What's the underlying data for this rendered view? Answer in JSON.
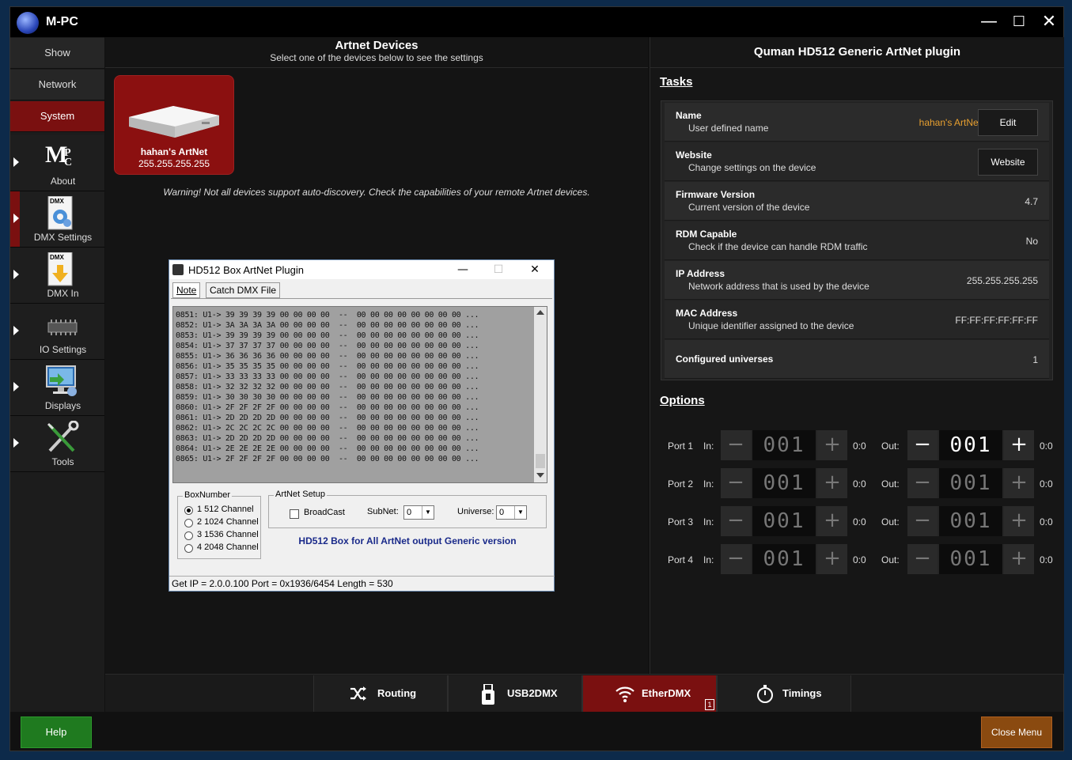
{
  "app": {
    "title": "M-PC"
  },
  "window_controls": {
    "minimize": "—",
    "maximize": "☐",
    "close": "✕"
  },
  "sidebar": {
    "buttons": [
      {
        "label": "Show",
        "active": false
      },
      {
        "label": "Network",
        "active": false
      },
      {
        "label": "System",
        "active": true
      }
    ],
    "items": [
      {
        "label": "About",
        "icon": "mc-logo-icon",
        "active": false
      },
      {
        "label": "DMX Settings",
        "icon": "dmx-settings-icon",
        "active": true
      },
      {
        "label": "DMX In",
        "icon": "dmx-in-icon",
        "active": false
      },
      {
        "label": "IO Settings",
        "icon": "chip-icon",
        "active": false
      },
      {
        "label": "Displays",
        "icon": "monitor-icon",
        "active": false
      },
      {
        "label": "Tools",
        "icon": "tools-icon",
        "active": false
      }
    ]
  },
  "center": {
    "title": "Artnet Devices",
    "subtitle": "Select one of the devices below to see the settings",
    "device": {
      "name": "hahan's ArtNet",
      "ip": "255.255.255.255"
    },
    "warning": "Warning! Not all devices support auto-discovery. Check the capabilities of your remote Artnet devices."
  },
  "right": {
    "title": "Quman HD512 Generic ArtNet plugin",
    "tasks_heading": "Tasks",
    "options_heading": "Options",
    "tasks": [
      {
        "name": "Name",
        "desc": "User defined name",
        "value": "hahan's ArtNet",
        "button": "Edit"
      },
      {
        "name": "Website",
        "desc": "Change settings on the device",
        "value": "",
        "button": "Website"
      },
      {
        "name": "Firmware Version",
        "desc": "Current version of the device",
        "value": "4.7",
        "button": ""
      },
      {
        "name": "RDM Capable",
        "desc": "Check if the device can handle RDM traffic",
        "value": "No",
        "button": ""
      },
      {
        "name": "IP Address",
        "desc": "Network address that is used by the device",
        "value": "255.255.255.255",
        "button": ""
      },
      {
        "name": "MAC Address",
        "desc": "Unique identifier assigned to the device",
        "value": "FF:FF:FF:FF:FF:FF",
        "button": ""
      },
      {
        "name": "Configured universes",
        "desc": "",
        "value": "1",
        "button": ""
      }
    ],
    "ports": [
      {
        "label": "Port 1",
        "in_label": "In:",
        "in_value": "001",
        "in_addr": "0:0",
        "out_label": "Out:",
        "out_value": "001",
        "out_addr": "0:0",
        "out_active": true
      },
      {
        "label": "Port 2",
        "in_label": "In:",
        "in_value": "001",
        "in_addr": "0:0",
        "out_label": "Out:",
        "out_value": "001",
        "out_addr": "0:0",
        "out_active": false
      },
      {
        "label": "Port 3",
        "in_label": "In:",
        "in_value": "001",
        "in_addr": "0:0",
        "out_label": "Out:",
        "out_value": "001",
        "out_addr": "0:0",
        "out_active": false
      },
      {
        "label": "Port 4",
        "in_label": "In:",
        "in_value": "001",
        "in_addr": "0:0",
        "out_label": "Out:",
        "out_value": "001",
        "out_addr": "0:0",
        "out_active": false
      }
    ]
  },
  "bottom_tabs": [
    {
      "label": "Routing",
      "icon": "shuffle-icon",
      "active": false
    },
    {
      "label": "USB2DMX",
      "icon": "usb-icon",
      "active": false
    },
    {
      "label": "EtherDMX",
      "icon": "wifi-icon",
      "active": true,
      "badge": "1"
    },
    {
      "label": "Timings",
      "icon": "stopwatch-icon",
      "active": false
    }
  ],
  "footer": {
    "help": "Help",
    "close_menu": "Close Menu"
  },
  "dialog": {
    "title": "HD512 Box ArtNet Plugin",
    "tabs": [
      "Note",
      "Catch DMX File"
    ],
    "log": [
      "0851: U1-> 39 39 39 39 00 00 00 00  --  00 00 00 00 00 00 00 00 ...",
      "0852: U1-> 3A 3A 3A 3A 00 00 00 00  --  00 00 00 00 00 00 00 00 ...",
      "0853: U1-> 39 39 39 39 00 00 00 00  --  00 00 00 00 00 00 00 00 ...",
      "0854: U1-> 37 37 37 37 00 00 00 00  --  00 00 00 00 00 00 00 00 ...",
      "0855: U1-> 36 36 36 36 00 00 00 00  --  00 00 00 00 00 00 00 00 ...",
      "0856: U1-> 35 35 35 35 00 00 00 00  --  00 00 00 00 00 00 00 00 ...",
      "0857: U1-> 33 33 33 33 00 00 00 00  --  00 00 00 00 00 00 00 00 ...",
      "0858: U1-> 32 32 32 32 00 00 00 00  --  00 00 00 00 00 00 00 00 ...",
      "0859: U1-> 30 30 30 30 00 00 00 00  --  00 00 00 00 00 00 00 00 ...",
      "0860: U1-> 2F 2F 2F 2F 00 00 00 00  --  00 00 00 00 00 00 00 00 ...",
      "0861: U1-> 2D 2D 2D 2D 00 00 00 00  --  00 00 00 00 00 00 00 00 ...",
      "0862: U1-> 2C 2C 2C 2C 00 00 00 00  --  00 00 00 00 00 00 00 00 ...",
      "0863: U1-> 2D 2D 2D 2D 00 00 00 00  --  00 00 00 00 00 00 00 00 ...",
      "0864: U1-> 2E 2E 2E 2E 00 00 00 00  --  00 00 00 00 00 00 00 00 ...",
      "0865: U1-> 2F 2F 2F 2F 00 00 00 00  --  00 00 00 00 00 00 00 00 ..."
    ],
    "boxnumber": {
      "label": "BoxNumber",
      "options": [
        {
          "label": "1 512   Channel",
          "selected": true
        },
        {
          "label": "2 1024 Channel",
          "selected": false
        },
        {
          "label": "3 1536 Channel",
          "selected": false
        },
        {
          "label": "4 2048 Channel",
          "selected": false
        }
      ]
    },
    "artnet_setup": {
      "label": "ArtNet Setup",
      "broadcast": "BroadCast",
      "subnet_label": "SubNet:",
      "subnet_value": "0",
      "universe_label": "Universe:",
      "universe_value": "0"
    },
    "info": "HD512 Box for All ArtNet output Generic version",
    "status": "Get IP = 2.0.0.100   Port = 0x1936/6454   Length = 530"
  }
}
